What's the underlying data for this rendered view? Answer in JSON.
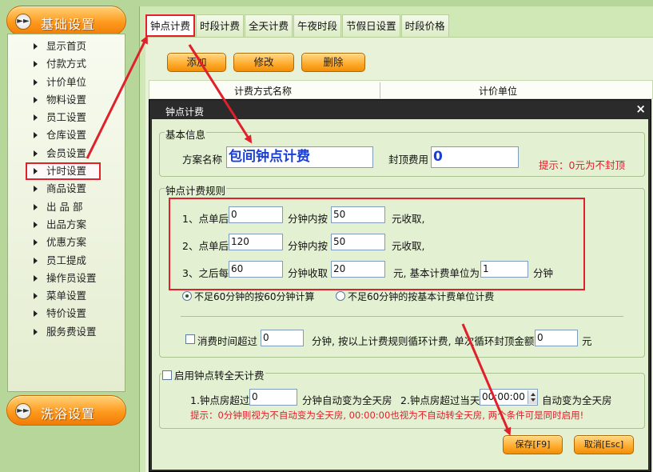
{
  "sidebar": {
    "category_top": "基础设置",
    "category_bottom": "洗浴设置",
    "items": [
      {
        "label": "显示首页"
      },
      {
        "label": "付款方式"
      },
      {
        "label": "计价单位"
      },
      {
        "label": "物料设置"
      },
      {
        "label": "员工设置"
      },
      {
        "label": "仓库设置"
      },
      {
        "label": "会员设置"
      },
      {
        "label": "计时设置",
        "highlighted": true
      },
      {
        "label": "商品设置"
      },
      {
        "label": "出 品 部"
      },
      {
        "label": "出品方案"
      },
      {
        "label": "优惠方案"
      },
      {
        "label": "员工提成"
      },
      {
        "label": "操作员设置"
      },
      {
        "label": "菜单设置"
      },
      {
        "label": "特价设置"
      },
      {
        "label": "服务费设置"
      }
    ]
  },
  "tabs": [
    {
      "label": "钟点计费",
      "active": true
    },
    {
      "label": "时段计费"
    },
    {
      "label": "全天计费"
    },
    {
      "label": "午夜时段"
    },
    {
      "label": "节假日设置"
    },
    {
      "label": "时段价格"
    }
  ],
  "toolbar": {
    "add": "添加",
    "edit": "修改",
    "delete": "删除"
  },
  "list": {
    "col_name": "计费方式名称",
    "col_unit": "计价单位"
  },
  "dialog": {
    "title": "钟点计费",
    "close": "×",
    "basic": {
      "group_title": "基本信息",
      "scheme_label": "方案名称",
      "scheme_value": "包间钟点计费",
      "cap_label": "封顶费用",
      "cap_value": "0",
      "hint": "提示：0元为不封顶"
    },
    "rules": {
      "group_title": "钟点计费规则",
      "row1": {
        "prefix": "1、点单后",
        "min": "0",
        "mid": "分钟内按",
        "amount": "50",
        "suffix": "元收取,"
      },
      "row2": {
        "prefix": "2、点单后",
        "min": "120",
        "mid": "分钟内按",
        "amount": "50",
        "suffix": "元收取,"
      },
      "row3": {
        "prefix": "3、之后每",
        "min": "60",
        "mid": "分钟收取",
        "amount": "20",
        "suffix": "元, 基本计费单位为",
        "unit": "1",
        "unit_suffix": "分钟"
      },
      "radio1": "不足60分钟的按60分钟计算",
      "radio2": "不足60分钟的按基本计费单位计费",
      "loop": {
        "prefix": "消费时间超过",
        "min": "0",
        "mid": "分钟, 按以上计费规则循环计费, 单次循环封顶金额为",
        "cap": "0",
        "suffix": "元"
      }
    },
    "fullday": {
      "group_title": "启用钟点转全天计费",
      "c1_prefix": "1.钟点房超过",
      "c1_value": "0",
      "c1_suffix": "分钟自动变为全天房",
      "c2_prefix": "2.钟点房超过当天",
      "c2_value": "00:00:00",
      "c2_suffix": "自动变为全天房",
      "hint": "提示：0分钟则视为不自动变为全天房, 00:00:00也视为不自动转全天房, 两个条件可是同时启用!"
    },
    "save": "保存[F9]",
    "cancel": "取消[Esc]"
  },
  "colors": {
    "accent_orange": "#ff9a1e",
    "annotation_red": "#e0202a",
    "hint_red": "#e0202a"
  }
}
